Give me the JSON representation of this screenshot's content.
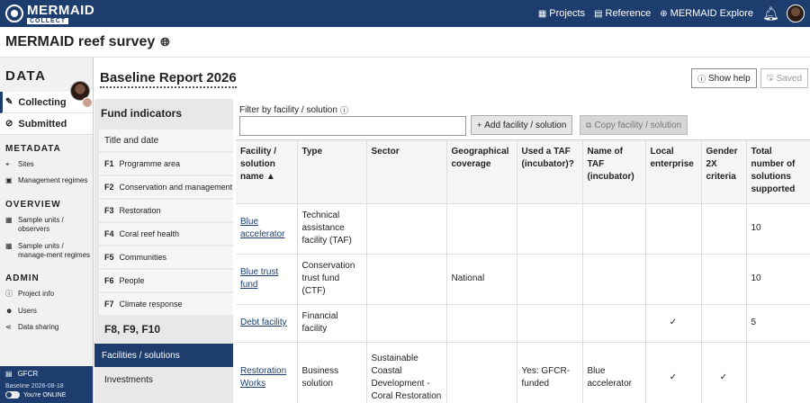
{
  "app": {
    "logo_main": "MERMAID",
    "logo_sub": "COLLECT",
    "nav": [
      {
        "label": "Projects",
        "icon": "projects-icon"
      },
      {
        "label": "Reference",
        "icon": "reference-icon"
      },
      {
        "label": "MERMAID Explore",
        "icon": "explore-icon"
      }
    ]
  },
  "project": {
    "title": "MERMAID reef survey"
  },
  "sidebar": {
    "title": "DATA",
    "tabs": [
      {
        "label": "Collecting",
        "icon": "edit-icon"
      },
      {
        "label": "Submitted",
        "icon": "check-circle-icon"
      }
    ],
    "sections": [
      {
        "heading": "METADATA",
        "items": [
          "Sites",
          "Management regimes"
        ]
      },
      {
        "heading": "OVERVIEW",
        "items": [
          "Sample units / observers",
          "Sample units / manage-ment regimes"
        ]
      },
      {
        "heading": "ADMIN",
        "items": [
          "Project info",
          "Users",
          "Data sharing"
        ]
      }
    ],
    "bottom": {
      "item": "GFCR",
      "meta": "Baseline 2026-08-18",
      "status": "You're ONLINE"
    }
  },
  "report": {
    "title": "Baseline  Report  2026",
    "help_label": "Show help",
    "saved_label": "Saved"
  },
  "fund": {
    "heading": "Fund indicators",
    "items": [
      {
        "code": "",
        "label": "Title and date"
      },
      {
        "code": "F1",
        "label": "Programme area"
      },
      {
        "code": "F2",
        "label": "Conservation and management"
      },
      {
        "code": "F3",
        "label": "Restoration"
      },
      {
        "code": "F4",
        "label": "Coral reef health"
      },
      {
        "code": "F5",
        "label": "Communities"
      },
      {
        "code": "F6",
        "label": "People"
      },
      {
        "code": "F7",
        "label": "Climate response"
      }
    ],
    "group": "F8, F9, F10",
    "active": "Facilities / solutions",
    "next": "Investments"
  },
  "filter": {
    "label": "Filter by facility / solution",
    "value": "",
    "add_label": "Add facility / solution",
    "copy_label": "Copy facility / solution"
  },
  "table": {
    "headers": [
      "Facility / solution name ▲",
      "Type",
      "Sector",
      "Geographical coverage",
      "Used a TAF (incubator)?",
      "Name of TAF (incubator)",
      "Local enterprise",
      "Gender 2X criteria",
      "Total number of solutions supported"
    ],
    "rows": [
      {
        "name": "Blue accelerator",
        "type": "Technical assistance facility (TAF)",
        "sector": "",
        "geo": "",
        "taf": "",
        "taf_name": "",
        "local": "",
        "gender": "",
        "total": "10"
      },
      {
        "name": "Blue trust fund",
        "type": "Conservation trust fund (CTF)",
        "sector": "",
        "geo": "National",
        "taf": "",
        "taf_name": "",
        "local": "",
        "gender": "",
        "total": "10"
      },
      {
        "name": "Debt facility",
        "type": "Financial facility",
        "sector": "",
        "geo": "",
        "taf": "",
        "taf_name": "",
        "local": "✓",
        "gender": "",
        "total": "5"
      },
      {
        "name": "Restoration Works",
        "type": "Business solution",
        "sector": "Sustainable Coastal Development - Coral Restoration",
        "geo": "",
        "taf": "Yes: GFCR-funded",
        "taf_name": "Blue accelerator",
        "local": "✓",
        "gender": "✓",
        "total": ""
      }
    ]
  }
}
